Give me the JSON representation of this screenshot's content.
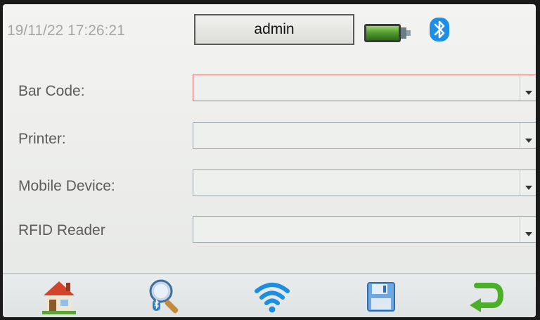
{
  "header": {
    "datetime": "19/11/22 17:26:21",
    "user": "admin"
  },
  "status_icons": [
    "battery-icon",
    "bluetooth-icon"
  ],
  "form": {
    "fields": [
      {
        "label": "Bar Code:",
        "value": ""
      },
      {
        "label": "Printer:",
        "value": ""
      },
      {
        "label": "Mobile Device:",
        "value": ""
      },
      {
        "label": "RFID Reader",
        "value": ""
      }
    ]
  },
  "toolbar": {
    "buttons": [
      "home-icon",
      "bluetooth-search-icon",
      "wifi-icon",
      "save-icon",
      "back-icon"
    ]
  },
  "colors": {
    "active_border": "#d66a6a",
    "wifi": "#1c8ee0",
    "back_arrow": "#4caf2a"
  }
}
